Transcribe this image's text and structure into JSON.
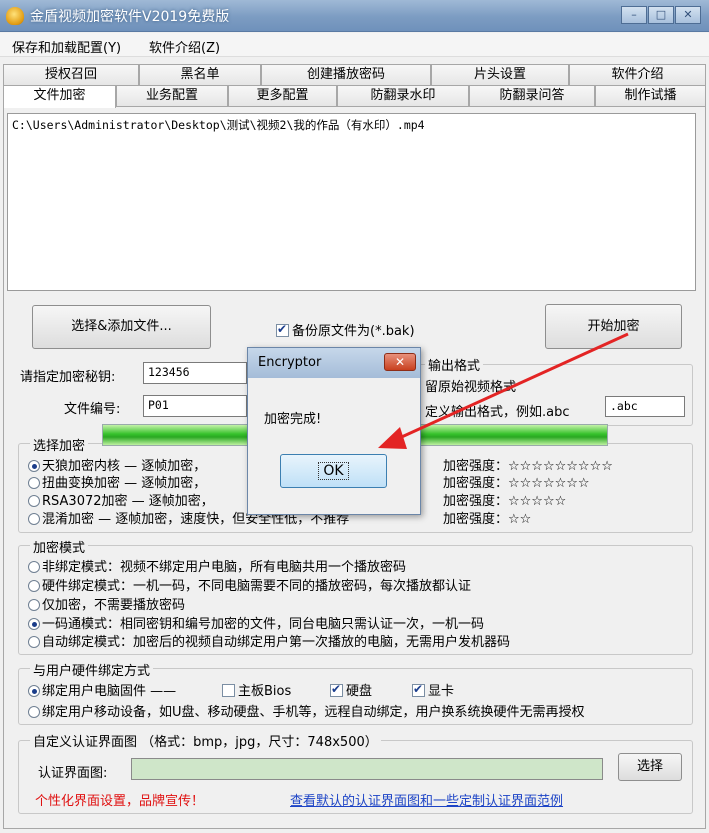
{
  "window": {
    "title": "金盾视频加密软件V2019免费版",
    "app_icon": "shield-icon",
    "min": "–",
    "max": "□",
    "close": "✕"
  },
  "menu": [
    "保存和加载配置(Y)",
    "软件介绍(Z)"
  ],
  "tabs_row1": [
    "授权召回",
    "黑名单",
    "创建播放密码",
    "片头设置",
    "软件介绍"
  ],
  "tabs_row2": [
    "文件加密",
    "业务配置",
    "更多配置",
    "防翻录水印",
    "防翻录问答",
    "制作试播"
  ],
  "active_tab": "文件加密",
  "file_list": [
    "C:\\Users\\Administrator\\Desktop\\测试\\视频2\\我的作品（有水印）.mp4"
  ],
  "buttons": {
    "select_file": "选择&添加文件...",
    "start": "开始加密",
    "select_image": "选择"
  },
  "backup": {
    "label": "备份原文件为(*.bak)",
    "checked": true
  },
  "password": {
    "label": "请指定加密秘钥:",
    "value": "123456"
  },
  "file_no": {
    "label": "文件编号:",
    "value": "P01"
  },
  "output": {
    "title": "输出格式",
    "keep": "留原始视频格式",
    "custom": "定义输出格式，例如.abc",
    "custom_value": ".abc"
  },
  "algo_group_title": "选择加密",
  "algorithms": [
    {
      "label": "天狼加密内核 — 逐帧加密，",
      "strength": "加密强度：☆☆☆☆☆☆☆☆☆",
      "selected": true
    },
    {
      "label": "扭曲变换加密 — 逐帧加密，",
      "strength": "加密强度：☆☆☆☆☆☆☆",
      "selected": false
    },
    {
      "label": "RSA3072加密 — 逐帧加密，",
      "strength": "加密强度：☆☆☆☆☆",
      "selected": false
    },
    {
      "label": "混淆加密 — 逐帧加密，速度快，但安全性低，不推荐",
      "strength": "加密强度：☆☆",
      "selected": false
    }
  ],
  "mode_group_title": "加密模式",
  "modes": [
    {
      "label": "非绑定模式：视频不绑定用户电脑，所有电脑共用一个播放密码",
      "selected": false
    },
    {
      "label": "硬件绑定模式：一机一码，不同电脑需要不同的播放密码，每次播放都认证",
      "selected": false
    },
    {
      "label": "仅加密，不需要播放密码",
      "selected": false
    },
    {
      "label": "一码通模式：相同密钥和编号加密的文件，同台电脑只需认证一次，一机一码",
      "selected": true
    },
    {
      "label": "自动绑定模式：加密后的视频自动绑定用户第一次播放的电脑，无需用户发机器码",
      "selected": false
    }
  ],
  "bind_group_title": "与用户硬件绑定方式",
  "bind_pc": {
    "label": "绑定用户电脑固件 ——",
    "selected": true
  },
  "bind_hw": [
    {
      "label": "主板Bios",
      "checked": false
    },
    {
      "label": "硬盘",
      "checked": true
    },
    {
      "label": "显卡",
      "checked": true
    }
  ],
  "bind_mobile": {
    "label": "绑定用户移动设备，如U盘、移动硬盘、手机等，远程自动绑定，用户换系统换硬件无需再授权",
    "selected": false
  },
  "auth_group_title": "自定义认证界面图 （格式：bmp，jpg，尺寸：748x500）",
  "auth_label": "认证界面图:",
  "promo": "个性化界面设置，品牌宣传！",
  "sample_link": "查看默认的认证界面图和一些定制认证界面范例",
  "dialog": {
    "title": "Encryptor",
    "message": "加密完成!",
    "ok": "OK",
    "close": "✕"
  },
  "colors": {
    "annotation_arrow": "#e32424",
    "progress": "#2aa822",
    "link": "#1d44c6",
    "promo": "#e01010"
  }
}
